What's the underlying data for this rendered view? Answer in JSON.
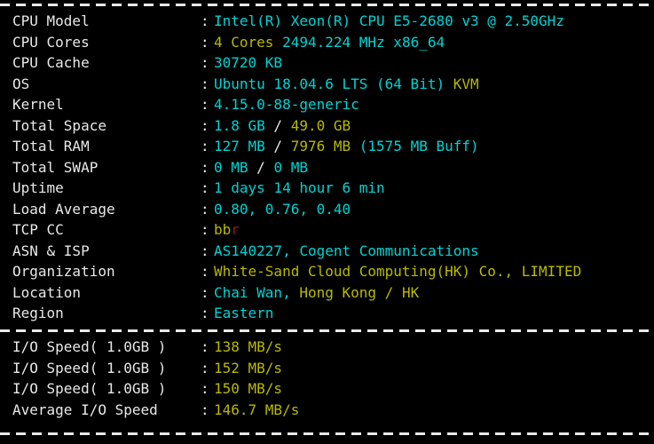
{
  "terminal": {
    "separator_glyph": "-",
    "colon": ":",
    "colors": {
      "background": "#000000",
      "label": "#e8e8e8",
      "cyan": "#00d3d3",
      "yellow": "#b9b900",
      "white": "#e8e8e8",
      "red": "#8c1a1a"
    }
  },
  "system_info": {
    "rows": [
      {
        "label": "CPU Model",
        "segments": [
          {
            "text": "Intel(R) Xeon(R) CPU E5-2680 v3 @ 2.50GHz",
            "color": "c"
          }
        ]
      },
      {
        "label": "CPU Cores",
        "segments": [
          {
            "text": "4 Cores",
            "color": "y"
          },
          {
            "text": " ",
            "color": "w"
          },
          {
            "text": "2494.224 MHz x86_64",
            "color": "c"
          }
        ]
      },
      {
        "label": "CPU Cache",
        "segments": [
          {
            "text": "30720 KB",
            "color": "c"
          }
        ]
      },
      {
        "label": "OS",
        "segments": [
          {
            "text": "Ubuntu 18.04.6 LTS (64 Bit)",
            "color": "c"
          },
          {
            "text": " ",
            "color": "w"
          },
          {
            "text": "KVM",
            "color": "y"
          }
        ]
      },
      {
        "label": "Kernel",
        "segments": [
          {
            "text": "4.15.0-88-generic",
            "color": "c"
          }
        ]
      },
      {
        "label": "Total Space",
        "segments": [
          {
            "text": "1.8 GB",
            "color": "c"
          },
          {
            "text": " / ",
            "color": "w"
          },
          {
            "text": "49.0 GB",
            "color": "y"
          }
        ]
      },
      {
        "label": "Total RAM",
        "segments": [
          {
            "text": "127 MB",
            "color": "c"
          },
          {
            "text": " / ",
            "color": "w"
          },
          {
            "text": "7976 MB",
            "color": "y"
          },
          {
            "text": " ",
            "color": "w"
          },
          {
            "text": "(1575 MB Buff)",
            "color": "c"
          }
        ]
      },
      {
        "label": "Total SWAP",
        "segments": [
          {
            "text": "0 MB",
            "color": "c"
          },
          {
            "text": " / ",
            "color": "w"
          },
          {
            "text": "0 MB",
            "color": "c"
          }
        ]
      },
      {
        "label": "Uptime",
        "segments": [
          {
            "text": "1 days 14 hour 6 min",
            "color": "c"
          }
        ]
      },
      {
        "label": "Load Average",
        "segments": [
          {
            "text": "0.80, 0.76, 0.40",
            "color": "c"
          }
        ]
      },
      {
        "label": "TCP CC",
        "segments": [
          {
            "text": "bb",
            "color": "y"
          },
          {
            "text": "r",
            "color": "r"
          }
        ]
      },
      {
        "label": "ASN & ISP",
        "segments": [
          {
            "text": "AS140227, Cogent Communications",
            "color": "c"
          }
        ]
      },
      {
        "label": "Organization",
        "segments": [
          {
            "text": "White-Sand Cloud Computing(HK) Co., LIMITED",
            "color": "y"
          }
        ]
      },
      {
        "label": "Location",
        "segments": [
          {
            "text": "Chai Wan,",
            "color": "c"
          },
          {
            "text": " ",
            "color": "w"
          },
          {
            "text": "Hong Kong / HK",
            "color": "y"
          }
        ]
      },
      {
        "label": "Region",
        "segments": [
          {
            "text": "Eastern",
            "color": "c"
          }
        ]
      }
    ]
  },
  "io_benchmark": {
    "rows": [
      {
        "label": "I/O Speed( 1.0GB )",
        "segments": [
          {
            "text": "138 MB/s",
            "color": "y"
          }
        ]
      },
      {
        "label": "I/O Speed( 1.0GB )",
        "segments": [
          {
            "text": "152 MB/s",
            "color": "y"
          }
        ]
      },
      {
        "label": "I/O Speed( 1.0GB )",
        "segments": [
          {
            "text": "150 MB/s",
            "color": "y"
          }
        ]
      },
      {
        "label": "Average I/O Speed",
        "segments": [
          {
            "text": "146.7 MB/s",
            "color": "y"
          }
        ]
      }
    ]
  }
}
